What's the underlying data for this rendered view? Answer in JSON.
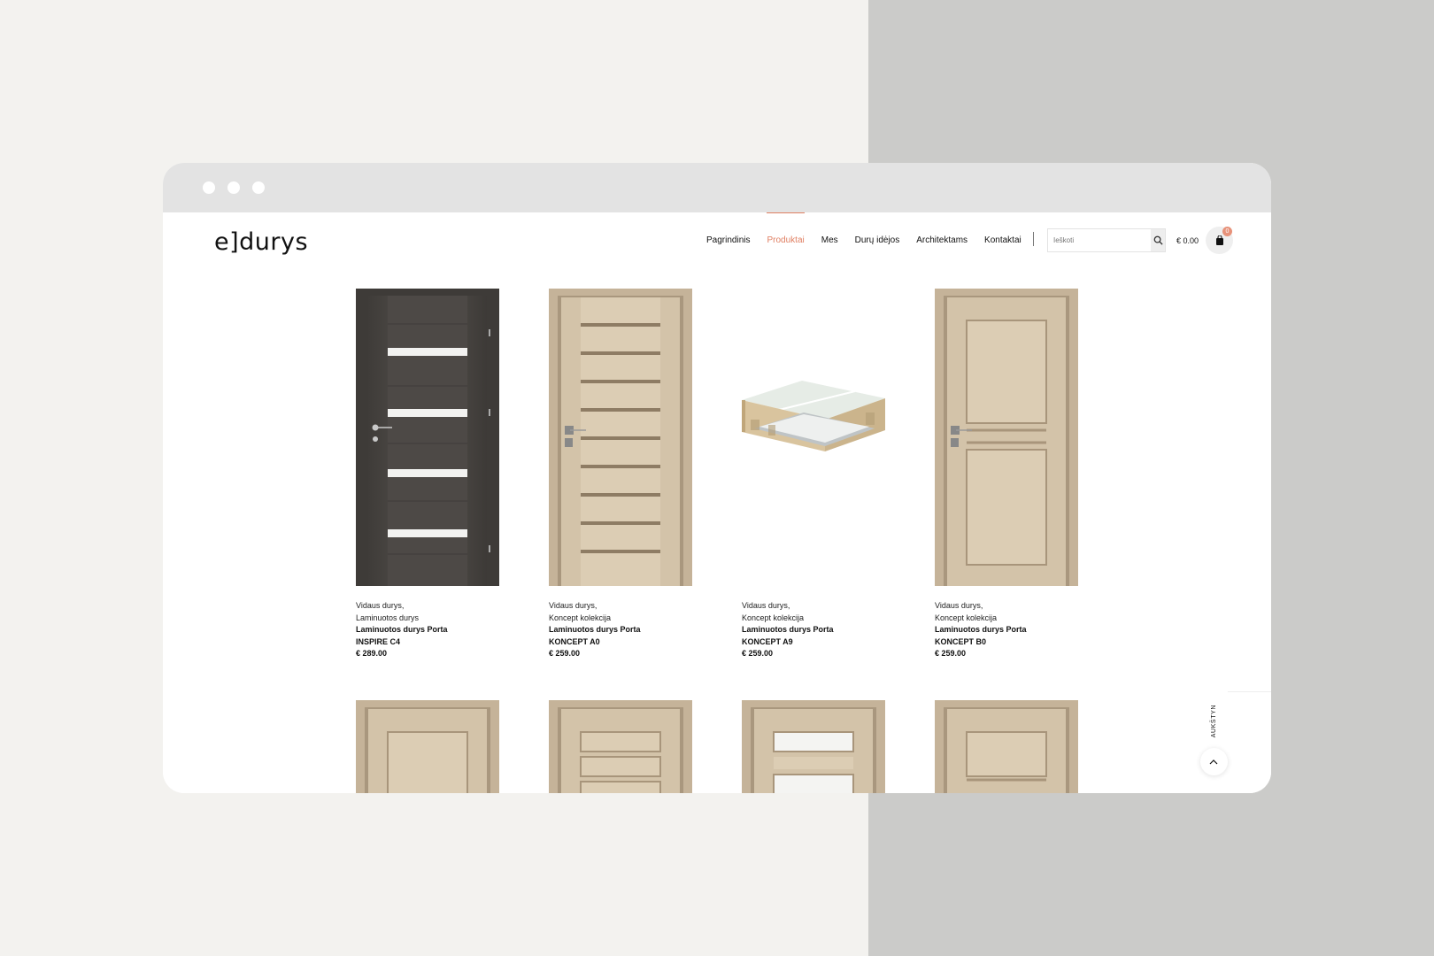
{
  "header": {
    "logo_text": "e]durys",
    "nav": [
      "Pagrindinis",
      "Produktai",
      "Mes",
      "Durų idėjos",
      "Architektams",
      "Kontaktai"
    ],
    "active_nav": "Produktai",
    "search_placeholder": "Ieškoti",
    "cart_total": "€ 0.00",
    "cart_count": "0"
  },
  "products": [
    {
      "cat1": "Vidaus durys,",
      "cat2": "Laminuotos durys",
      "name": "Laminuotos durys Porta",
      "model": "INSPIRE C4",
      "price": "€ 289.00"
    },
    {
      "cat1": "Vidaus durys,",
      "cat2": "Koncept kolekcija",
      "name": "Laminuotos durys Porta",
      "model": "KONCEPT A0",
      "price": "€ 259.00"
    },
    {
      "cat1": "Vidaus durys,",
      "cat2": "Koncept kolekcija",
      "name": "Laminuotos durys Porta",
      "model": "KONCEPT A9",
      "price": "€ 259.00"
    },
    {
      "cat1": "Vidaus durys,",
      "cat2": "Koncept kolekcija",
      "name": "Laminuotos durys Porta",
      "model": "KONCEPT B0",
      "price": "€ 259.00"
    }
  ],
  "back_to_top": "AUKŠTYN",
  "colors": {
    "accent": "#e07f62",
    "dark_wood": "#4a4744",
    "light_wood": "#cdbba0"
  }
}
